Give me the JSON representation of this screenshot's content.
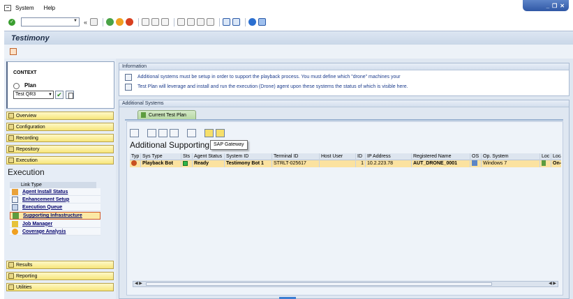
{
  "menubar": {
    "items": [
      "System",
      "Help"
    ]
  },
  "window_controls": [
    "_",
    "❐",
    "✕"
  ],
  "header": {
    "title": "Testimony"
  },
  "context": {
    "heading": "CONTEXT",
    "plan_label": "Plan",
    "plan_value": "Test QR3"
  },
  "nav": {
    "top_items": [
      "Overview",
      "Configuration",
      "Recording",
      "Repository",
      "Execution"
    ],
    "section_heading": "Execution",
    "link_type_header": "Link Type",
    "links": [
      "Agent Install Status",
      "Enhancement Setup",
      "Execution Queue",
      "Supporting Infrastructure",
      "Job Manager",
      "Coverage Analysis"
    ],
    "bottom_items": [
      "Results",
      "Reporting",
      "Utilities"
    ]
  },
  "info": {
    "heading": "Information",
    "line1": "Additional systems must be setup in order to support the playback process. You must define which \"drone\" machines your",
    "line2": "Test Plan will leverage and install and run the execution (Drone) agent upon these systems the status of which is visible here."
  },
  "systems": {
    "heading": "Additional Systems",
    "tab_label": "Current Test Plan",
    "grid_title": "Additional Supporting",
    "tooltip": "SAP Gateway",
    "columns": [
      "Typ",
      "Sys Type",
      "Sts",
      "Agent Status",
      "System ID",
      "Terminal ID",
      "Host User",
      "ID",
      "IP Address",
      "Registered Name",
      "OS",
      "Op. System",
      "Loc",
      "Locat"
    ],
    "rows": [
      {
        "sys_type": "Playback Bot",
        "agent_status": "Ready",
        "system_id": "Testimony Bot 1",
        "terminal_id": "STRLT-025617",
        "host_user": "",
        "id": "1",
        "ip": "10.2.223.78",
        "registered_name": "AUT_DRONE_0001",
        "op_system": "Windows 7",
        "location": "On-p"
      }
    ]
  },
  "colors": {
    "nav_button": "#f7e67a",
    "selected_row": "#fbe2a0",
    "status_ready": "#2fb54a",
    "title_bg": "#cad7e8"
  }
}
